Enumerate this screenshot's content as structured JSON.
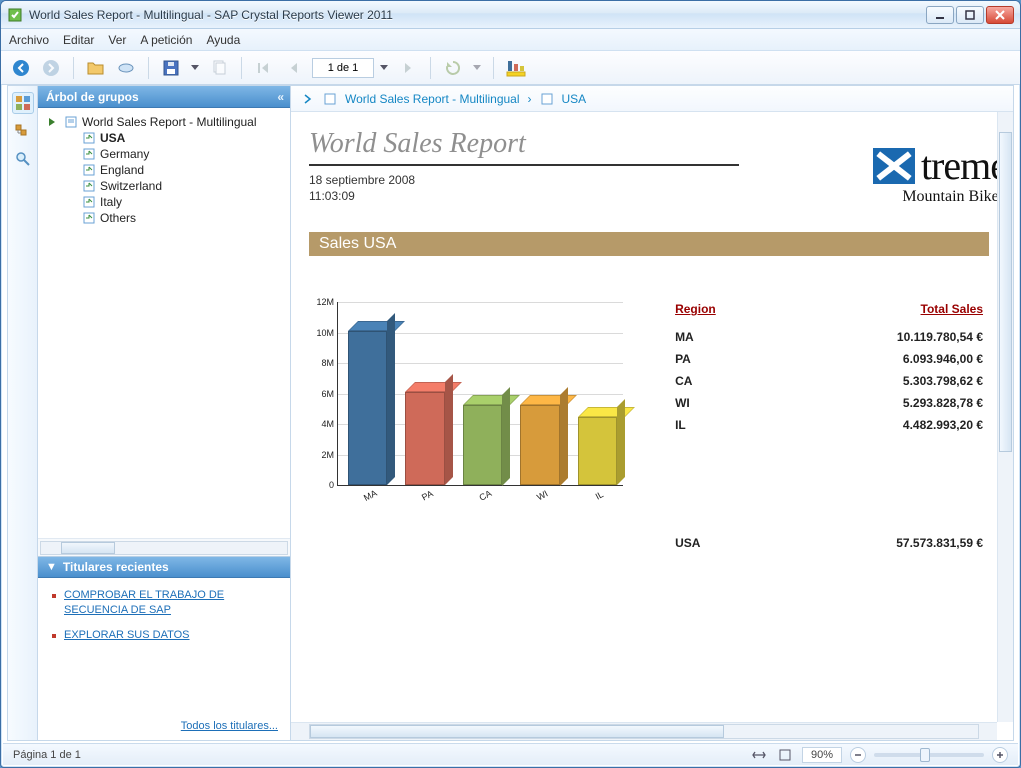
{
  "window": {
    "title": "World Sales Report - Multilingual - SAP Crystal Reports Viewer 2011"
  },
  "menu": {
    "items": [
      "Archivo",
      "Editar",
      "Ver",
      "A petición",
      "Ayuda"
    ]
  },
  "toolbar": {
    "page_label": "1 de 1"
  },
  "sidepanel": {
    "group_tree_title": "Árbol de grupos",
    "tree": {
      "root": "World Sales Report - Multilingual",
      "nodes": [
        "USA",
        "Germany",
        "England",
        "Switzerland",
        "Italy",
        "Others"
      ],
      "selected": "USA"
    },
    "headlines_title": "Titulares recientes",
    "headlines": [
      "COMPROBAR EL TRABAJO DE SECUENCIA DE SAP",
      "EXPLORAR SUS DATOS"
    ],
    "all_headlines": "Todos los titulares..."
  },
  "breadcrumbs": {
    "items": [
      "World Sales Report - Multilingual",
      "USA"
    ]
  },
  "report": {
    "title": "World Sales Report",
    "date": "18 septiembre 2008",
    "time": "11:03:09",
    "brand_word": "treme",
    "brand_sub": "Mountain Bikes",
    "band": "Sales USA",
    "table_headers": {
      "region": "Region",
      "sales": "Total Sales"
    },
    "rows": [
      {
        "region": "MA",
        "sales": "10.119.780,54 €"
      },
      {
        "region": "PA",
        "sales": "6.093.946,00 €"
      },
      {
        "region": "CA",
        "sales": "5.303.798,62 €"
      },
      {
        "region": "WI",
        "sales": "5.293.828,78 €"
      },
      {
        "region": "IL",
        "sales": "4.482.993,20 €"
      }
    ],
    "total": {
      "region": "USA",
      "sales": "57.573.831,59 €"
    }
  },
  "statusbar": {
    "page": "Página 1 de 1",
    "zoom": "90%"
  },
  "chart_data": {
    "type": "bar",
    "categories": [
      "MA",
      "PA",
      "CA",
      "WI",
      "IL"
    ],
    "values": [
      10119780.54,
      6093946.0,
      5303798.62,
      5293828.78,
      4482993.2
    ],
    "colors": [
      "#3f6f9b",
      "#cf6a59",
      "#8fb05b",
      "#d79b3b",
      "#d4c43b"
    ],
    "ylabel": "",
    "ylim": [
      0,
      12000000
    ],
    "yticks": [
      0,
      2000000,
      4000000,
      6000000,
      8000000,
      10000000,
      12000000
    ],
    "ytick_labels": [
      "0",
      "2M",
      "4M",
      "6M",
      "8M",
      "10M",
      "12M"
    ]
  }
}
